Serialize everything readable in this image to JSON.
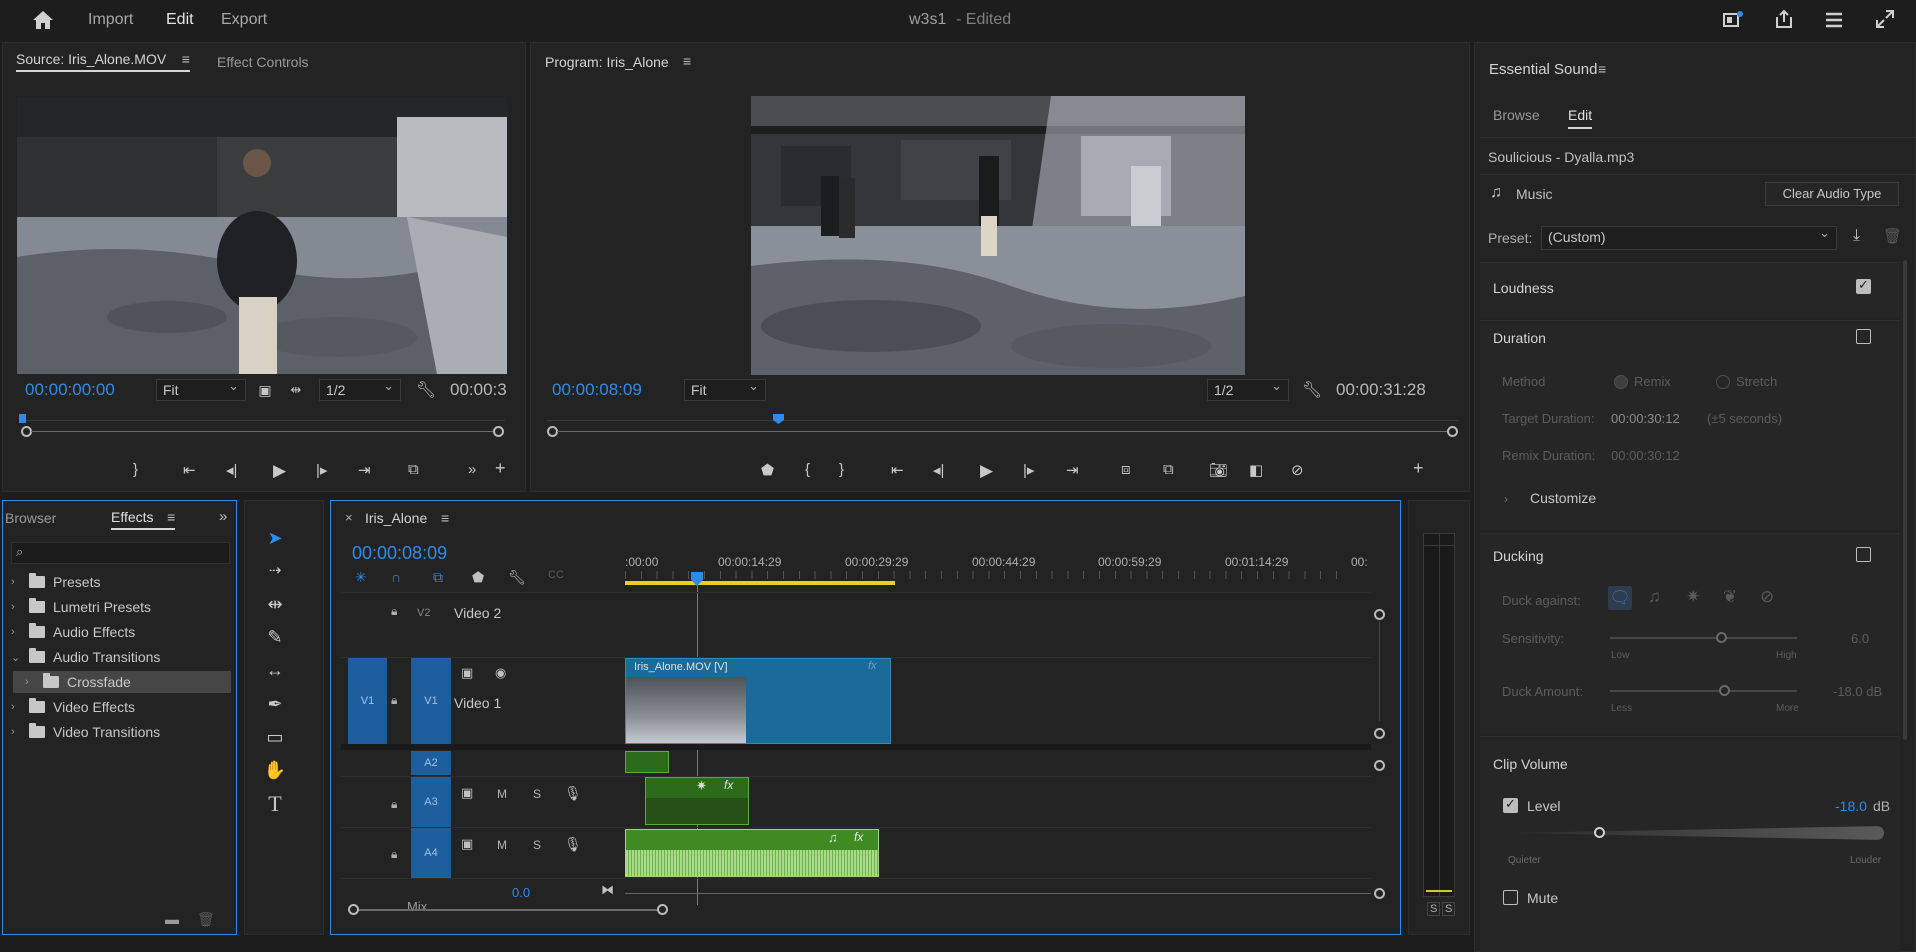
{
  "topbar": {
    "nav": [
      "Import",
      "Edit",
      "Export"
    ],
    "active_nav": "Edit",
    "project_title": "w3s1",
    "edited_label": "- Edited"
  },
  "source_monitor": {
    "tab_source": "Source: Iris_Alone.MOV",
    "tab_effect_controls": "Effect Controls",
    "timecode": "00:00:00:00",
    "fit": "Fit",
    "resolution": "1/2",
    "duration": "00:00:3"
  },
  "program_monitor": {
    "tab": "Program: Iris_Alone",
    "timecode": "00:00:08:09",
    "fit": "Fit",
    "resolution": "1/2",
    "duration": "00:00:31:28"
  },
  "effects_panel": {
    "tab_browser": "Browser",
    "tab_effects": "Effects",
    "items": [
      {
        "label": "Presets",
        "expanded": false,
        "indent": 0
      },
      {
        "label": "Lumetri Presets",
        "expanded": false,
        "indent": 0
      },
      {
        "label": "Audio Effects",
        "expanded": false,
        "indent": 0
      },
      {
        "label": "Audio Transitions",
        "expanded": true,
        "indent": 0
      },
      {
        "label": "Crossfade",
        "expanded": false,
        "indent": 1,
        "selected": true
      },
      {
        "label": "Video Effects",
        "expanded": false,
        "indent": 0
      },
      {
        "label": "Video Transitions",
        "expanded": false,
        "indent": 0
      }
    ]
  },
  "timeline": {
    "sequence_name": "Iris_Alone",
    "timecode": "00:00:08:09",
    "ruler_labels": [
      ":00:00",
      "00:00:14:29",
      "00:00:29:29",
      "00:00:44:29",
      "00:00:59:29",
      "00:01:14:29",
      "00:"
    ],
    "tracks": {
      "v2": {
        "id": "V2",
        "name": "Video 2"
      },
      "v1": {
        "src": "V1",
        "id": "V1",
        "name": "Video 1"
      },
      "a2": {
        "id": "A2"
      },
      "a3": {
        "id": "A3"
      },
      "a4": {
        "id": "A4"
      },
      "mix": {
        "label": "Mix",
        "value": "0.0"
      }
    },
    "track_buttons": {
      "m": "M",
      "s": "S"
    },
    "clip_v1": "Iris_Alone.MOV [V]",
    "fx": "fx"
  },
  "meter": {
    "s1": "S",
    "s2": "S"
  },
  "essential_sound": {
    "title": "Essential Sound",
    "tab_browse": "Browse",
    "tab_edit": "Edit",
    "clip_name": "Soulicious - Dyalla.mp3",
    "type": "Music",
    "clear_button": "Clear Audio Type",
    "preset_label": "Preset:",
    "preset_value": "(Custom)",
    "loudness": "Loudness",
    "loudness_checked": true,
    "duration": "Duration",
    "duration_checked": false,
    "method_label": "Method",
    "remix_label": "Remix",
    "stretch_label": "Stretch",
    "target_duration_label": "Target Duration:",
    "target_duration_value": "00:00:30:12",
    "target_duration_hint": "(±5 seconds)",
    "remix_duration_label": "Remix Duration:",
    "remix_duration_value": "00:00:30:12",
    "customize": "Customize",
    "ducking": "Ducking",
    "ducking_checked": false,
    "duck_against_label": "Duck against:",
    "sensitivity_label": "Sensitivity:",
    "sensitivity_low": "Low",
    "sensitivity_high": "High",
    "sensitivity_value": "6.0",
    "duck_amount_label": "Duck Amount:",
    "duck_less": "Less",
    "duck_more": "More",
    "duck_amount_value": "-18.0 dB",
    "clip_volume": "Clip Volume",
    "level_label": "Level",
    "level_checked": true,
    "level_value": "-18.0",
    "level_unit": "dB",
    "quieter": "Quieter",
    "louder": "Louder",
    "mute_label": "Mute",
    "mute_checked": false
  }
}
